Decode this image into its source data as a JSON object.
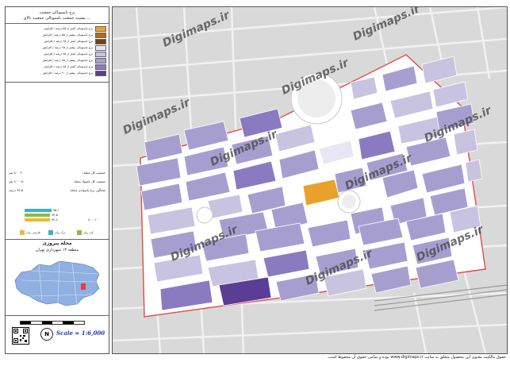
{
  "legend": {
    "title": "نرخ ناسیونالی جمعیت",
    "subtitle": "بیشینه جمعیت ناسیونالی جمعیت بالای ...",
    "classes": [
      {
        "label": "نرخ ناسیونالی کمتر از ۵۵ درصد / افزایش",
        "color": "#e8a22c"
      },
      {
        "label": "نرخ ناسیونالی بیشتر از ۵۵ درصد / افزایش",
        "color": "#b46a1a"
      },
      {
        "label": "نرخ ناسیونالی کمتر از ۶۵ درصد / افزایش",
        "color": "#7b3e12"
      },
      {
        "label": "نرخ ناسیونالی بیشتر از ۶۵ درصد / افزایش",
        "color": "#e9e6f3"
      },
      {
        "label": "نرخ ناسیونالی کمتر از ۷۵ درصد / افزایش",
        "color": "#c8c3e0"
      },
      {
        "label": "نرخ ناسیونالی بیشتر از ۷۵ درصد / افزایش",
        "color": "#a79ed0"
      },
      {
        "label": "نرخ ناسیونالی کمتر از ۸۵ درصد / افزایش",
        "color": "#8a7bc0"
      },
      {
        "label": "نرخ ناسیونالی بیشتر از ۹۰ درصد / افزایش",
        "color": "#5a3d94"
      }
    ]
  },
  "stats": [
    {
      "label": "جمعیت کل محله:",
      "value": "۳ ۸۰۰ نفر"
    },
    {
      "label": "جمعیت کل باسواد محله:",
      "value": "۱۸ ۸۰۰ نفر"
    },
    {
      "label": "میانگین نرخ باسوادی محله:",
      "value": "۹۴.۵ درصد"
    }
  ],
  "bars": [
    {
      "label": "۹۵.۱",
      "color": "#3bb2c4",
      "fraction": 0.28
    },
    {
      "label": "۹۴.۵",
      "color": "#87bf3a",
      "fraction": 0.27
    },
    {
      "label": "۹۴.۸",
      "color": "#f0b63a",
      "fraction": 0.27
    }
  ],
  "bar_axis_label": "۸۰ - ۱۰۰",
  "categories": [
    {
      "label": "فارسی زبان",
      "color": "#f0b63a"
    },
    {
      "label": "ترک زبان",
      "color": "#3bb2c4"
    },
    {
      "label": "کرد زبان",
      "color": "#87bf3a"
    }
  ],
  "region": {
    "name": "محله پیروزی",
    "sub": "منطقه ۱۳ شهرداری تهران"
  },
  "scale": "Scale = 1:6,000",
  "watermark": "Digimaps.ir",
  "footer": "حقوق مالکیت معنوی این محصول متعلق به سایت www.digimaps.ir بوده و تمامی حقوق آن محفوظ است."
}
